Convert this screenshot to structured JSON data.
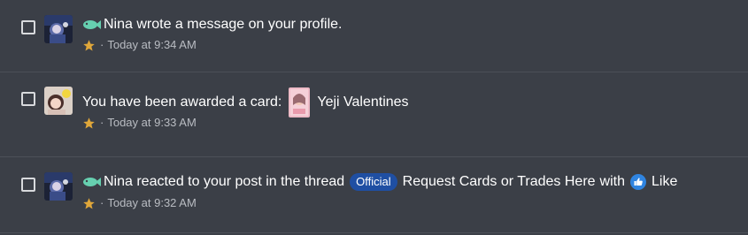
{
  "colors": {
    "background": "#3b3f47",
    "divider": "#4c5058",
    "star": "#e0a73a",
    "meta_text": "#b9bcc2",
    "official_badge": "#1f4fa3",
    "fish": "#66d0b0",
    "like": "#2f84e0"
  },
  "alerts": [
    {
      "icon": "fish-icon",
      "username": "Nina",
      "text": " wrote a message on your profile.",
      "time": "Today at 9:34 AM"
    },
    {
      "text": "You have been awarded a card:",
      "card_name": "Yeji Valentines",
      "time": "Today at 9:33 AM"
    },
    {
      "icon": "fish-icon",
      "username": "Nina",
      "text": " reacted to your post in the thread",
      "badge": "Official",
      "thread": "Request Cards or Trades Here",
      "with_text": "with",
      "reaction": "Like",
      "time": "Today at 9:32 AM"
    }
  ],
  "separator": "·"
}
